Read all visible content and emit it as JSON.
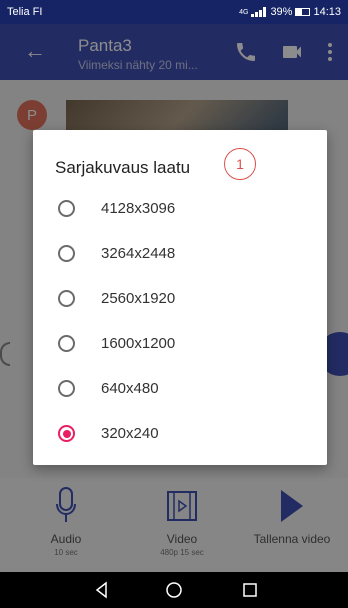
{
  "status": {
    "carrier": "Telia FI",
    "network": "4G",
    "battery": "39%",
    "time": "14:13"
  },
  "appbar": {
    "title": "Panta3",
    "subtitle": "Viimeksi nähty 20 mi..."
  },
  "chat": {
    "avatar_letter": "P"
  },
  "bottom_bar": {
    "audio": {
      "label": "Audio",
      "sub": "10 sec"
    },
    "video": {
      "label": "Video",
      "sub": "480p 15 sec"
    },
    "record": {
      "label": "Tallenna video"
    }
  },
  "dialog": {
    "title": "Sarjakuvaus laatu",
    "badge": "1",
    "options": [
      {
        "label": "4128x3096",
        "selected": false
      },
      {
        "label": "3264x2448",
        "selected": false
      },
      {
        "label": "2560x1920",
        "selected": false
      },
      {
        "label": "1600x1200",
        "selected": false
      },
      {
        "label": "640x480",
        "selected": false
      },
      {
        "label": "320x240",
        "selected": true
      }
    ]
  },
  "colors": {
    "appbar": "#3f51b5",
    "statusbar": "#162466",
    "accent": "#e91e63",
    "badge": "#d9534f"
  }
}
